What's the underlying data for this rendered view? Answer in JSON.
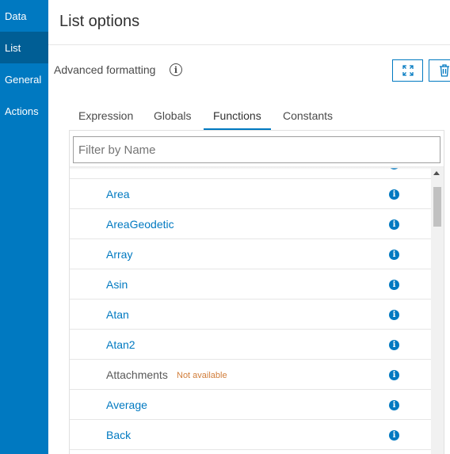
{
  "sidebar": {
    "items": [
      {
        "label": "Data",
        "active": false
      },
      {
        "label": "List",
        "active": true
      },
      {
        "label": "General",
        "active": false
      },
      {
        "label": "Actions",
        "active": false
      }
    ]
  },
  "header": {
    "title": "List options"
  },
  "advanced": {
    "label": "Advanced formatting",
    "info_icon": "info-circle-icon",
    "expand_icon": "expand-icon",
    "delete_icon": "trash-icon"
  },
  "tabs": [
    {
      "label": "Expression"
    },
    {
      "label": "Globals"
    },
    {
      "label": "Functions",
      "selected": true
    },
    {
      "label": "Constants"
    }
  ],
  "filter": {
    "placeholder": "Filter by Name",
    "value": ""
  },
  "functions": [
    {
      "name": "Area",
      "available": true
    },
    {
      "name": "AreaGeodetic",
      "available": true
    },
    {
      "name": "Array",
      "available": true
    },
    {
      "name": "Asin",
      "available": true
    },
    {
      "name": "Atan",
      "available": true
    },
    {
      "name": "Atan2",
      "available": true
    },
    {
      "name": "Attachments",
      "available": false,
      "note": "Not available"
    },
    {
      "name": "Average",
      "available": true
    },
    {
      "name": "Back",
      "available": true
    }
  ],
  "colors": {
    "accent": "#0079c1",
    "nav_active": "#005e95",
    "not_available": "#d17d3a"
  }
}
